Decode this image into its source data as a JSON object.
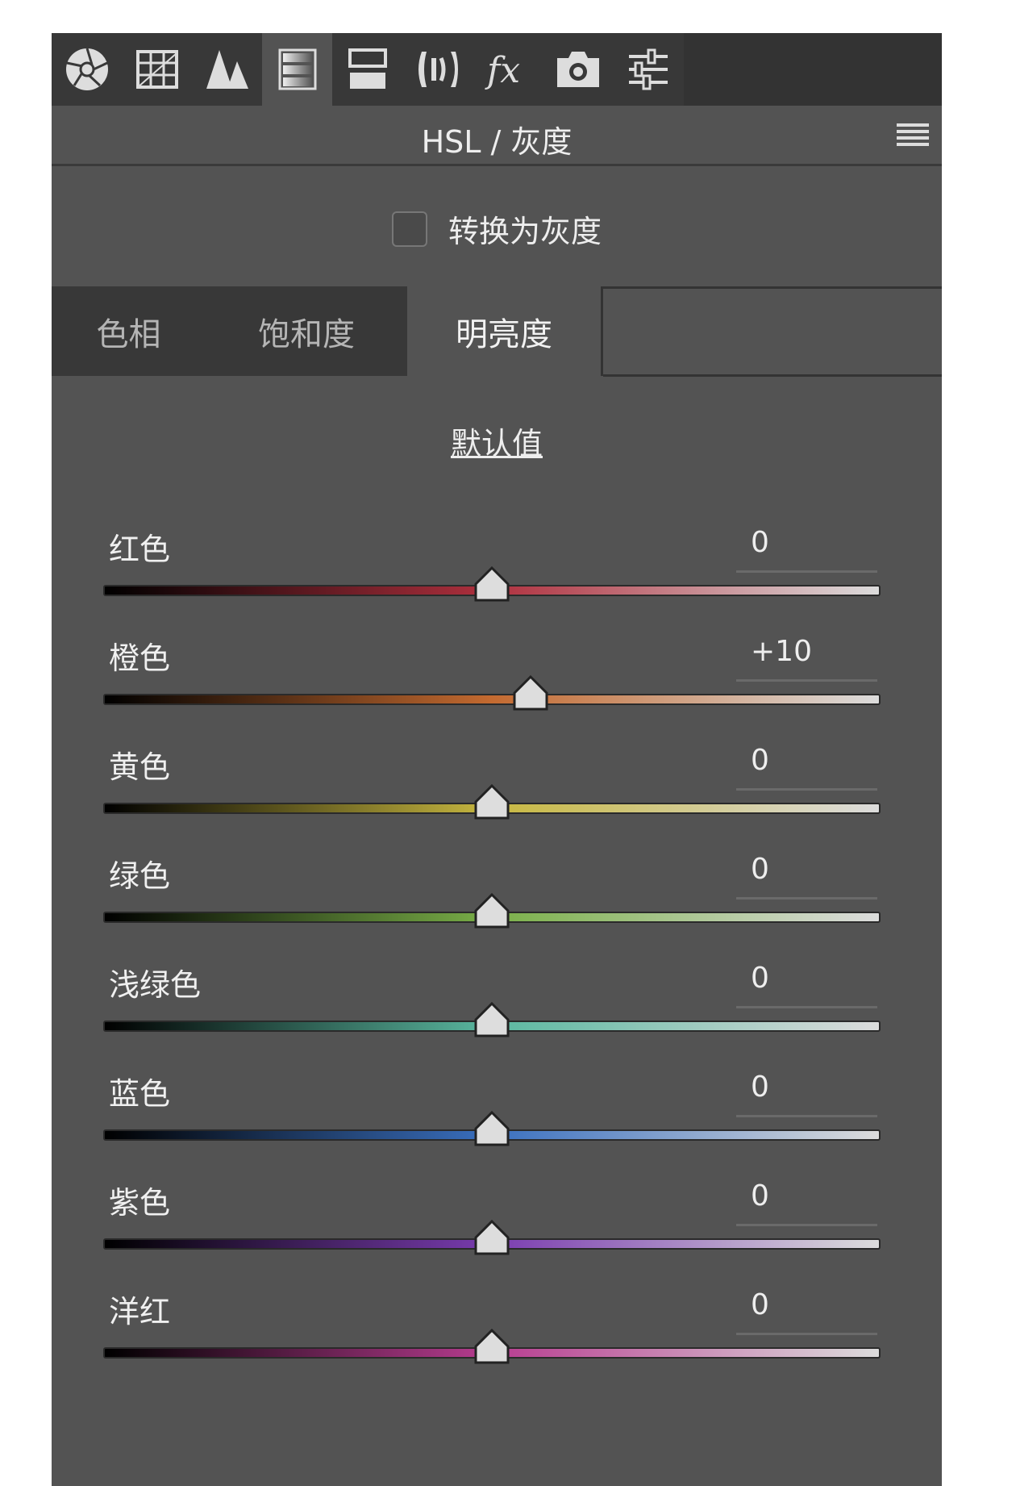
{
  "toolbar": {
    "icons": [
      "basic-icon",
      "tone-curve-icon",
      "detail-icon",
      "hsl-grayscale-icon",
      "split-toning-icon",
      "lens-corrections-icon",
      "effects-icon",
      "camera-calibration-icon",
      "presets-icon"
    ],
    "active": "hsl-grayscale-icon"
  },
  "header": {
    "title": "HSL / 灰度"
  },
  "convert": {
    "label": "转换为灰度",
    "checked": false
  },
  "tabs": [
    {
      "label": "色相"
    },
    {
      "label": "饱和度"
    },
    {
      "label": "明亮度",
      "active": true
    }
  ],
  "default_label": "默认值",
  "sliders": [
    {
      "label": "红色",
      "value": 0,
      "display": "0",
      "color": "#b0303e"
    },
    {
      "label": "橙色",
      "value": 10,
      "display": "+10",
      "color": "#c46a30"
    },
    {
      "label": "黄色",
      "value": 0,
      "display": "0",
      "color": "#c8b840"
    },
    {
      "label": "绿色",
      "value": 0,
      "display": "0",
      "color": "#7ab048"
    },
    {
      "label": "浅绿色",
      "value": 0,
      "display": "0",
      "color": "#5ab8a0"
    },
    {
      "label": "蓝色",
      "value": 0,
      "display": "0",
      "color": "#3a70c0"
    },
    {
      "label": "紫色",
      "value": 0,
      "display": "0",
      "color": "#7a3cb0"
    },
    {
      "label": "洋红",
      "value": 0,
      "display": "0",
      "color": "#b83c90"
    }
  ]
}
